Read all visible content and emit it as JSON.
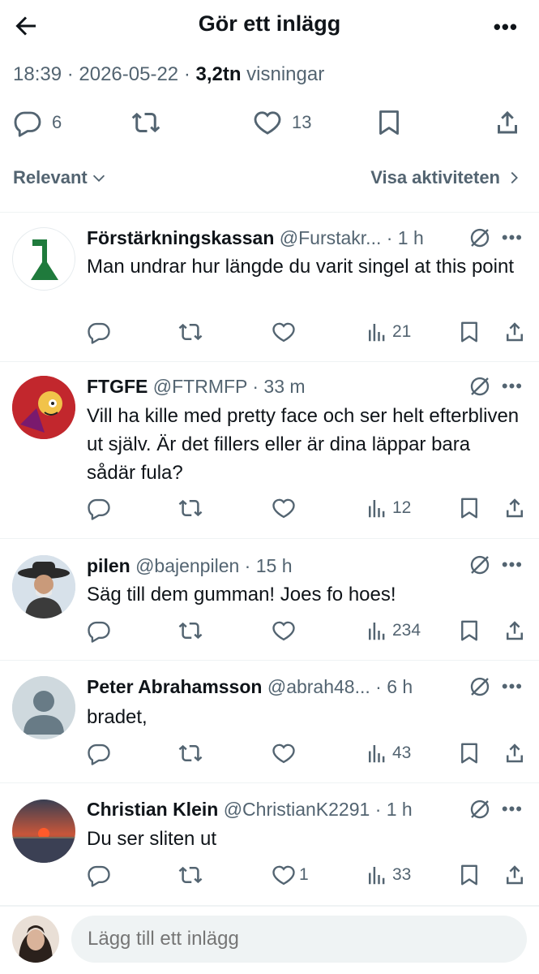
{
  "header": {
    "title": "Gör ett inlägg",
    "more": "•••"
  },
  "post_meta": {
    "time": "18:39",
    "sep1": " · ",
    "date": "2026-05-22",
    "sep2": " · ",
    "views_count": "3,2tn",
    "views_label": " visningar"
  },
  "post_actions": {
    "replies": "6",
    "likes": "13"
  },
  "sort": {
    "relevance": "Relevant",
    "activity": "Visa aktiviteten"
  },
  "replies": [
    {
      "name": "Förstärkningskassan",
      "handle": "@Furstakr...",
      "time": " · 1 h",
      "text": "Man undrar hur längde du varit singel at this point",
      "likes": "",
      "views": "21"
    },
    {
      "name": "FTGFE",
      "handle": "@FTRMFP",
      "time": " · 33 m",
      "text": "Vill ha kille med pretty face och ser helt efterbliven ut själv. Är det fillers eller är dina läppar bara sådär fula?",
      "likes": "",
      "views": "12"
    },
    {
      "name": "pilen",
      "handle": "@bajenpilen",
      "time": " · 15 h",
      "text": "Säg till dem gumman! Joes fo hoes!",
      "likes": "",
      "views": "234"
    },
    {
      "name": "Peter Abrahamsson",
      "handle": "@abrah48...",
      "time": " · 6 h",
      "text": "bradet,",
      "likes": "",
      "views": "43"
    },
    {
      "name": "Christian Klein",
      "handle": "@ChristianK2291",
      "time": " · 1 h",
      "text": "Du ser sliten ut",
      "likes": "1",
      "views": "33"
    }
  ],
  "composer": {
    "placeholder": "Lägg till ett inlägg"
  },
  "colors": {
    "text": "#0f1419",
    "secondary": "#536471",
    "divider": "#eff3f4",
    "input_bg": "#eff3f4"
  }
}
